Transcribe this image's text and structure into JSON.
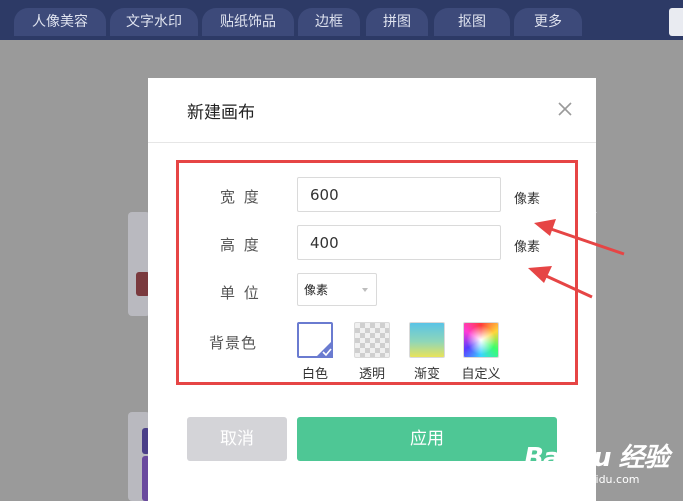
{
  "toolbar": {
    "tabs": [
      "人像美容",
      "文字水印",
      "贴纸饰品",
      "边框",
      "拼图",
      "抠图",
      "更多"
    ]
  },
  "dialog": {
    "title": "新建画布",
    "width_label": "宽 度",
    "width_value": "600",
    "height_label": "高 度",
    "height_value": "400",
    "unit_suffix_width": "像素",
    "unit_suffix_height": "像素",
    "unit_label": "单 位",
    "unit_selected": "像素",
    "bg_label": "背景色",
    "bg_options": [
      "白色",
      "透明",
      "渐变",
      "自定义"
    ],
    "cancel_label": "取消",
    "apply_label": "应用"
  },
  "watermark": {
    "main": "Bai du 经验",
    "sub": "jingyan.baidu.com"
  },
  "colors": {
    "toolbar_bg": "#2d3a66",
    "apply_green": "#4ec795",
    "highlight_red": "#e64545",
    "selected_border": "#6a7bd0"
  }
}
